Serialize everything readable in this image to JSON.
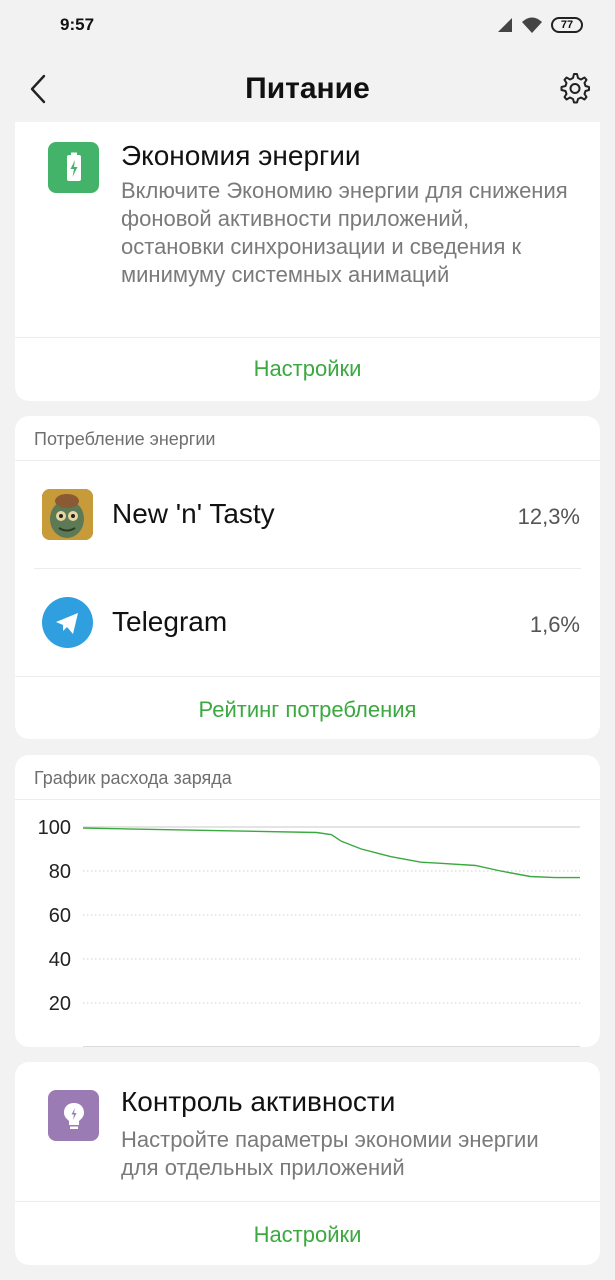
{
  "status_bar": {
    "time": "9:57",
    "battery_level": "77"
  },
  "header": {
    "title": "Питание"
  },
  "battery_saver": {
    "title": "Экономия энергии",
    "description": "Включите Экономию энергии для снижения фоновой активности приложений, остановки синхронизации и сведения к минимуму системных анимаций",
    "action_label": "Настройки",
    "icon": "battery-charging-icon",
    "icon_color": "#43b36a"
  },
  "consumption": {
    "section_label": "Потребление энергии",
    "apps": [
      {
        "name": "New 'n' Tasty",
        "percent": "12,3%",
        "icon": "new-n-tasty-app-icon"
      },
      {
        "name": "Telegram",
        "percent": "1,6%",
        "icon": "telegram-app-icon"
      }
    ],
    "action_label": "Рейтинг потребления"
  },
  "battery_chart": {
    "section_label": "График расхода заряда"
  },
  "chart_data": {
    "type": "line",
    "title": "График расхода заряда",
    "xlabel": "",
    "ylabel": "",
    "ylim": [
      0,
      100
    ],
    "yticks": [
      100,
      80,
      60,
      40,
      20
    ],
    "grid": true,
    "series": [
      {
        "x": [
          0,
          0.47,
          0.5,
          0.52,
          0.56,
          0.62,
          0.68,
          0.72,
          0.79,
          0.84,
          0.9,
          0.95,
          1.0
        ],
        "values": [
          99.5,
          97.5,
          96.5,
          93.5,
          90,
          86.5,
          84,
          83.5,
          82.5,
          80,
          77.5,
          77,
          77
        ]
      }
    ],
    "line_color": "#3aa93f"
  },
  "activity_control": {
    "title": "Контроль активности",
    "description": "Настройте параметры экономии энергии для отдельных приложений",
    "action_label": "Настройки",
    "icon": "lightbulb-icon",
    "icon_color": "#9b7bb3"
  },
  "accent_color": "#3aa93f"
}
